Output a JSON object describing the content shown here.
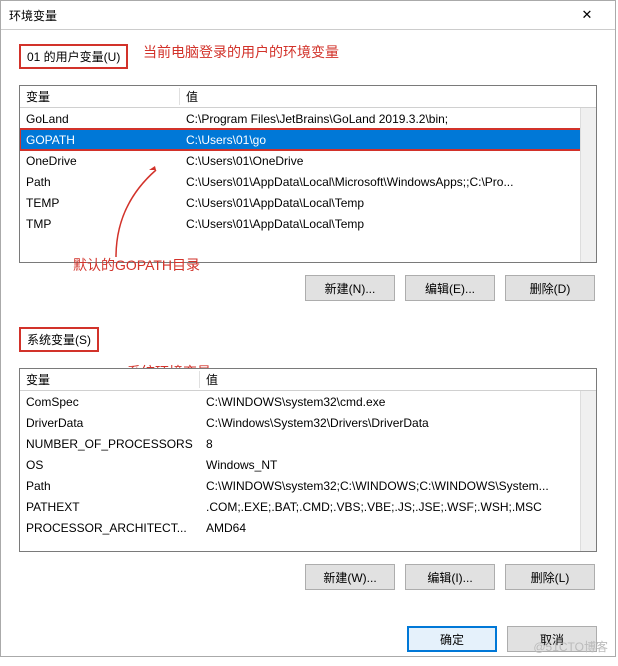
{
  "title": "环境变量",
  "close": "✕",
  "userSection": {
    "label": "01 的用户变量(U)",
    "annotation": "当前电脑登录的用户的环境变量",
    "headers": {
      "name": "变量",
      "value": "值"
    },
    "rows": [
      {
        "name": "GoLand",
        "value": "C:\\Program Files\\JetBrains\\GoLand 2019.3.2\\bin;"
      },
      {
        "name": "GOPATH",
        "value": "C:\\Users\\01\\go"
      },
      {
        "name": "OneDrive",
        "value": "C:\\Users\\01\\OneDrive"
      },
      {
        "name": "Path",
        "value": "C:\\Users\\01\\AppData\\Local\\Microsoft\\WindowsApps;;C:\\Pro..."
      },
      {
        "name": "TEMP",
        "value": "C:\\Users\\01\\AppData\\Local\\Temp"
      },
      {
        "name": "TMP",
        "value": "C:\\Users\\01\\AppData\\Local\\Temp"
      }
    ],
    "selectedIndex": 1,
    "gopathAnnotation": "默认的GOPATH目录",
    "buttons": {
      "new": "新建(N)...",
      "edit": "编辑(E)...",
      "delete": "删除(D)"
    }
  },
  "sysSection": {
    "label": "系统变量(S)",
    "annotation": "系统环境变量",
    "headers": {
      "name": "变量",
      "value": "值"
    },
    "rows": [
      {
        "name": "ComSpec",
        "value": "C:\\WINDOWS\\system32\\cmd.exe"
      },
      {
        "name": "DriverData",
        "value": "C:\\Windows\\System32\\Drivers\\DriverData"
      },
      {
        "name": "NUMBER_OF_PROCESSORS",
        "value": "8"
      },
      {
        "name": "OS",
        "value": "Windows_NT"
      },
      {
        "name": "Path",
        "value": "C:\\WINDOWS\\system32;C:\\WINDOWS;C:\\WINDOWS\\System..."
      },
      {
        "name": "PATHEXT",
        "value": ".COM;.EXE;.BAT;.CMD;.VBS;.VBE;.JS;.JSE;.WSF;.WSH;.MSC"
      },
      {
        "name": "PROCESSOR_ARCHITECT...",
        "value": "AMD64"
      }
    ],
    "buttons": {
      "new": "新建(W)...",
      "edit": "编辑(I)...",
      "delete": "删除(L)"
    }
  },
  "footer": {
    "ok": "确定",
    "cancel": "取消"
  },
  "watermark": "@51CTO博客"
}
